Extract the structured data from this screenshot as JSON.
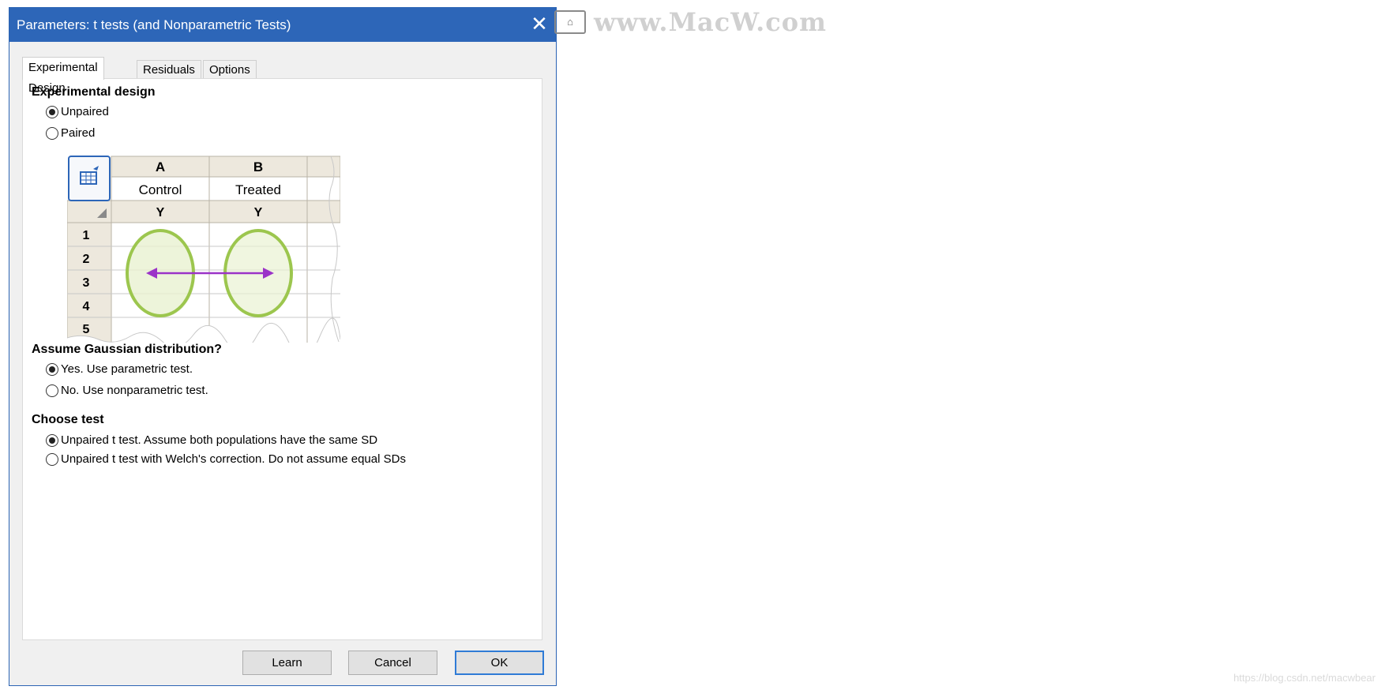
{
  "dialog": {
    "title": "Parameters: t tests (and Nonparametric Tests)",
    "close_glyph": "✕"
  },
  "tabs": [
    {
      "label": "Experimental Design",
      "active": true
    },
    {
      "label": "Residuals",
      "active": false
    },
    {
      "label": "Options",
      "active": false
    }
  ],
  "experimental_design": {
    "heading": "Experimental design",
    "options": [
      {
        "label": "Unpaired",
        "selected": true
      },
      {
        "label": "Paired",
        "selected": false
      }
    ]
  },
  "sheet": {
    "columns": [
      "A",
      "B"
    ],
    "column_titles": [
      "Control",
      "Treated"
    ],
    "subheaders": [
      "Y",
      "Y"
    ],
    "rows": [
      "1",
      "2",
      "3",
      "4",
      "5"
    ],
    "colors": {
      "header_fill": "#ede8dd",
      "ellipse_stroke": "#9cc64e",
      "ellipse_fill": "#e6f0cf",
      "arrow": "#9b33c8"
    }
  },
  "gaussian": {
    "heading": "Assume Gaussian distribution?",
    "options": [
      {
        "label": "Yes. Use parametric test.",
        "selected": true
      },
      {
        "label": "No. Use nonparametric test.",
        "selected": false
      }
    ]
  },
  "choose_test": {
    "heading": "Choose test",
    "options": [
      {
        "label": "Unpaired t test. Assume both populations have the same SD",
        "selected": true
      },
      {
        "label": "Unpaired t test with Welch's correction. Do not assume equal SDs",
        "selected": false
      }
    ]
  },
  "buttons": {
    "learn": "Learn",
    "cancel": "Cancel",
    "ok": "OK"
  },
  "watermark": {
    "text": "www.MacW.com",
    "footer": "https://blog.csdn.net/macwbear"
  },
  "colors": {
    "titlebar": "#2d66b8",
    "ok_border": "#2f7bd6"
  }
}
